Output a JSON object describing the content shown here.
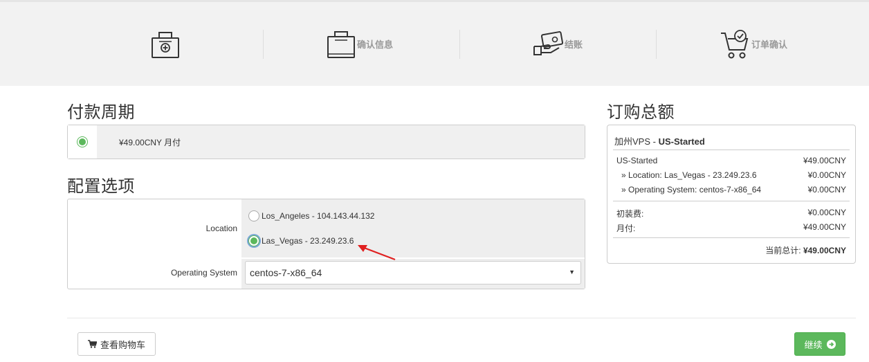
{
  "steps": [
    {
      "icon": "bag-plus-icon",
      "label": ""
    },
    {
      "icon": "bag-icon",
      "label": "确认信息"
    },
    {
      "icon": "card-hand-icon",
      "label": "结账"
    },
    {
      "icon": "cart-check-icon",
      "label": "订单确认"
    }
  ],
  "billing": {
    "title": "付款周期",
    "option_label": "¥49.00CNY 月付",
    "selected": true
  },
  "config": {
    "title": "配置选项",
    "location_label": "Location",
    "location_options": [
      {
        "label": "Los_Angeles - 104.143.44.132",
        "selected": false
      },
      {
        "label": "Las_Vegas - 23.249.23.6",
        "selected": true
      }
    ],
    "os_label": "Operating System",
    "os_value": "centos-7-x86_64"
  },
  "summary": {
    "title": "订购总额",
    "product_group": "加州VPS - ",
    "product_name": "US-Started",
    "lines": [
      {
        "label": "US-Started",
        "value": "¥49.00CNY"
      },
      {
        "label": "» Location: Las_Vegas - 23.249.23.6",
        "value": "¥0.00CNY"
      },
      {
        "label": "» Operating System: centos-7-x86_64",
        "value": "¥0.00CNY"
      }
    ],
    "setup_label": "初装费:",
    "setup_value": "¥0.00CNY",
    "recurring_label": "月付:",
    "recurring_value": "¥49.00CNY",
    "total_label": "当前总计: ",
    "total_value": "¥49.00CNY"
  },
  "actions": {
    "view_cart": "查看购物车",
    "continue": "继续"
  },
  "colors": {
    "accent_green": "#5cb85c",
    "annotation_arrow": "#e02020"
  }
}
